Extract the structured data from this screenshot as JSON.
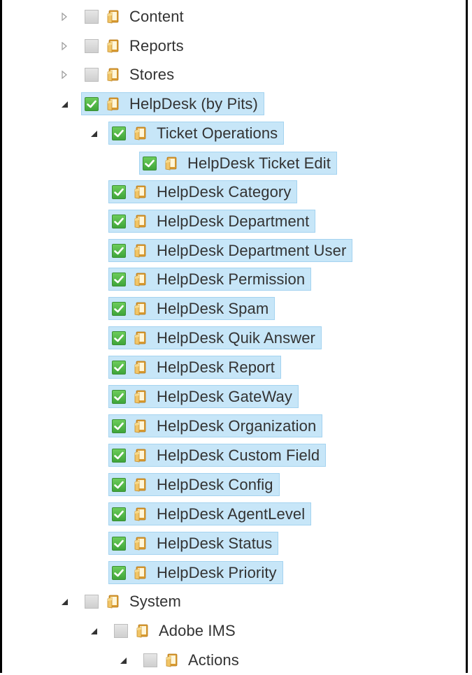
{
  "colors": {
    "selection_bg": "#c7e6f8",
    "selection_border": "#a4d3f0",
    "checkbox_checked": "#4fb444",
    "checkbox_unchecked": "#d9d9d9",
    "folder": "#e8b24a",
    "text": "#333333"
  },
  "tree": {
    "nodes": [
      {
        "label": "Content",
        "state": "collapsed",
        "checked": false,
        "selected": false,
        "icon": "folder-icon"
      },
      {
        "label": "Reports",
        "state": "collapsed",
        "checked": false,
        "selected": false,
        "icon": "folder-icon"
      },
      {
        "label": "Stores",
        "state": "collapsed",
        "checked": false,
        "selected": false,
        "icon": "folder-icon"
      },
      {
        "label": "HelpDesk (by Pits)",
        "state": "expanded",
        "checked": true,
        "selected": true,
        "icon": "folder-icon"
      },
      {
        "label": "Ticket Operations",
        "state": "expanded",
        "checked": true,
        "selected": true,
        "icon": "folder-icon"
      },
      {
        "label": "HelpDesk Ticket Edit",
        "state": "leaf",
        "checked": true,
        "selected": true,
        "icon": "folder-icon"
      },
      {
        "label": "HelpDesk Category",
        "state": "leaf",
        "checked": true,
        "selected": true,
        "icon": "folder-icon"
      },
      {
        "label": "HelpDesk Department",
        "state": "leaf",
        "checked": true,
        "selected": true,
        "icon": "folder-icon"
      },
      {
        "label": "HelpDesk Department User",
        "state": "leaf",
        "checked": true,
        "selected": true,
        "icon": "folder-icon"
      },
      {
        "label": "HelpDesk Permission",
        "state": "leaf",
        "checked": true,
        "selected": true,
        "icon": "folder-icon"
      },
      {
        "label": "HelpDesk Spam",
        "state": "leaf",
        "checked": true,
        "selected": true,
        "icon": "folder-icon"
      },
      {
        "label": "HelpDesk Quik Answer",
        "state": "leaf",
        "checked": true,
        "selected": true,
        "icon": "folder-icon"
      },
      {
        "label": "HelpDesk Report",
        "state": "leaf",
        "checked": true,
        "selected": true,
        "icon": "folder-icon"
      },
      {
        "label": "HelpDesk GateWay",
        "state": "leaf",
        "checked": true,
        "selected": true,
        "icon": "folder-icon"
      },
      {
        "label": "HelpDesk Organization",
        "state": "leaf",
        "checked": true,
        "selected": true,
        "icon": "folder-icon"
      },
      {
        "label": "HelpDesk Custom Field",
        "state": "leaf",
        "checked": true,
        "selected": true,
        "icon": "folder-icon"
      },
      {
        "label": "HelpDesk Config",
        "state": "leaf",
        "checked": true,
        "selected": true,
        "icon": "folder-icon"
      },
      {
        "label": "HelpDesk AgentLevel",
        "state": "leaf",
        "checked": true,
        "selected": true,
        "icon": "folder-icon"
      },
      {
        "label": "HelpDesk Status",
        "state": "leaf",
        "checked": true,
        "selected": true,
        "icon": "folder-icon"
      },
      {
        "label": "HelpDesk Priority",
        "state": "leaf",
        "checked": true,
        "selected": true,
        "icon": "folder-icon"
      },
      {
        "label": "System",
        "state": "expanded",
        "checked": false,
        "selected": false,
        "icon": "folder-icon"
      },
      {
        "label": "Adobe IMS",
        "state": "expanded",
        "checked": false,
        "selected": false,
        "icon": "folder-icon"
      },
      {
        "label": "Actions",
        "state": "expanded",
        "checked": false,
        "selected": false,
        "icon": "folder-icon"
      }
    ]
  }
}
